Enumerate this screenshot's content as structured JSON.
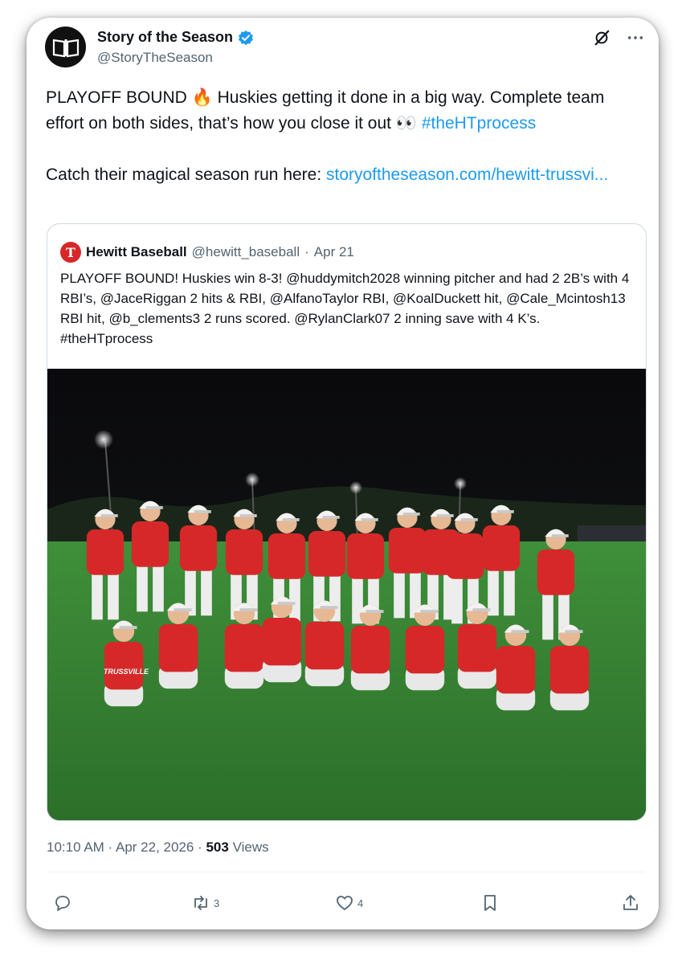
{
  "author": {
    "name": "Story of the Season",
    "handle": "@StoryTheSeason",
    "verified": true
  },
  "post": {
    "text_1": "PLAYOFF BOUND 🔥 Huskies getting it done in a big way. Complete team effort on both sides, that’s how you close it out 👀 ",
    "hashtag": "#theHTprocess",
    "text_2": "Catch their magical season run here: ",
    "link": "storyoftheseason.com/hewitt-trussvi..."
  },
  "quote": {
    "avatar_letter": "T",
    "name": "Hewitt Baseball",
    "handle": "@hewitt_baseball",
    "dot": "·",
    "date": "Apr 21",
    "text": "PLAYOFF BOUND!  Huskies win 8-3!  @huddymitch2028 winning pitcher and had 2 2B’s with 4 RBI’s, @JaceRiggan 2 hits & RBI, @AlfanoTaylor RBI, @KoalDuckett hit, @Cale_Mcintosh13 RBI hit, @b_clements3 2 runs scored. @RylanClark07 2 inning save with 4 K’s. #theHTprocess",
    "jersey_text": "TRUSSVILLE"
  },
  "meta": {
    "time_date": "10:10 AM · Apr 22, 2026 · ",
    "views_count": "503",
    "views_label": " Views"
  },
  "actions": {
    "reposts": "3",
    "likes": "4"
  },
  "colors": {
    "accent": "#1d9bf0",
    "text": "#0f1419",
    "muted": "#536471",
    "border": "#cfd9de",
    "jersey_red": "#d62828"
  },
  "icons": [
    "grok-icon",
    "more-icon",
    "verified-icon",
    "reply-icon",
    "repost-icon",
    "like-icon",
    "bookmark-icon",
    "share-icon"
  ]
}
